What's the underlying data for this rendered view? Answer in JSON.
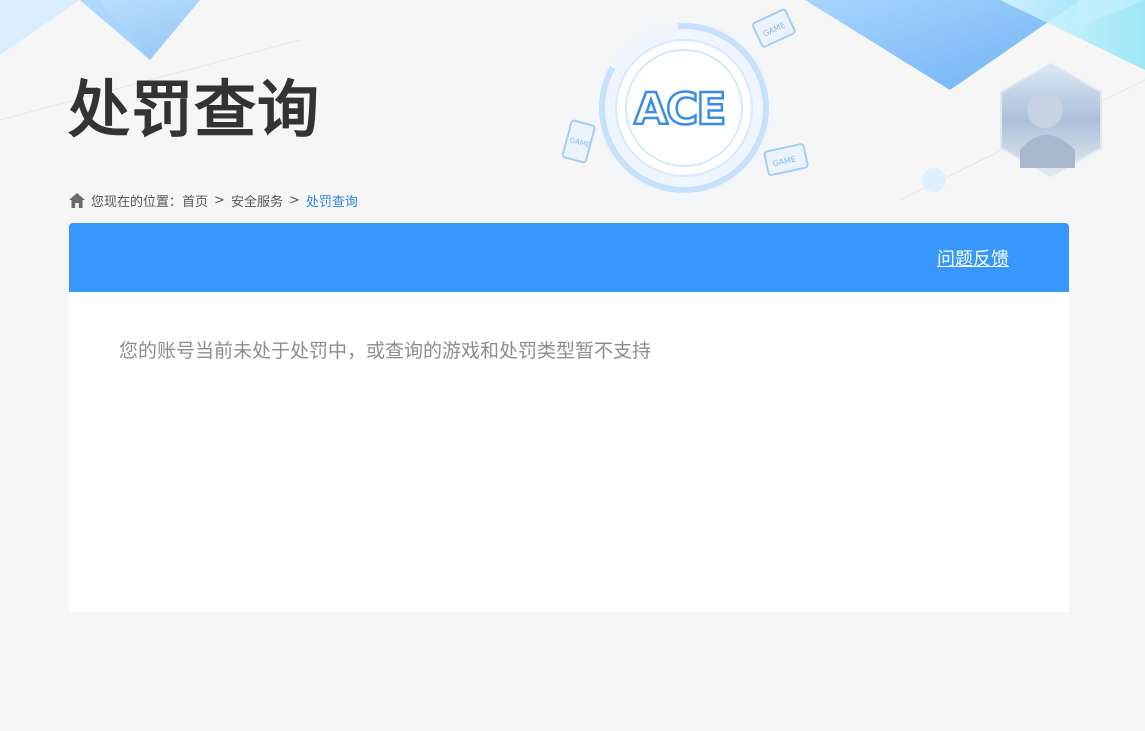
{
  "page": {
    "title": "处罚查询"
  },
  "header_art": {
    "logo_text": "ACE",
    "device_labels": [
      "GAME",
      "GAME",
      "GAME"
    ],
    "accent_color": "#3797fd"
  },
  "breadcrumb": {
    "prefix": "您现在的位置：",
    "items": [
      {
        "label": "首页"
      },
      {
        "label": "安全服务"
      },
      {
        "label": "处罚查询",
        "current": true
      }
    ],
    "separator": ">"
  },
  "panel": {
    "feedback_label": "问题反馈",
    "message": "您的账号当前未处于处罚中，或查询的游戏和处罚类型暂不支持"
  }
}
